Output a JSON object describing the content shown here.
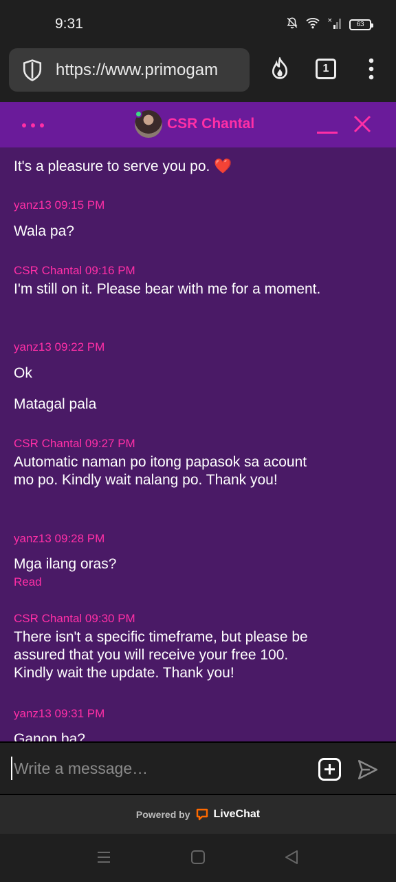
{
  "status_bar": {
    "time": "9:31",
    "battery": "63"
  },
  "browser": {
    "url": "https://www.primogam",
    "tab_count": "1",
    "icons": [
      "shield-icon",
      "fire-icon",
      "tabs-icon",
      "more-vertical-icon"
    ]
  },
  "chat": {
    "agent_name": "CSR Chantal",
    "header_icons": [
      "more-horizontal-icon",
      "minimize-icon",
      "close-icon"
    ],
    "accent_color": "#ff2fa6",
    "header_color": "#6a1b9a",
    "messages_bg": "#4a1a66"
  },
  "messages": {
    "m0": {
      "text": "It's a pleasure to serve you po. ❤️"
    },
    "m1": {
      "meta": "yanz13 09:15 PM",
      "text": "Wala pa?"
    },
    "m2": {
      "meta": "CSR Chantal 09:16 PM",
      "text": "I'm still on it. Please bear with me for a moment."
    },
    "m3": {
      "meta": "yanz13 09:22 PM",
      "text": "Ok",
      "text2": "Matagal pala"
    },
    "m4": {
      "meta": "CSR Chantal 09:27 PM",
      "text": "Automatic naman po itong papasok sa acount mo po. Kindly wait nalang po. Thank you!"
    },
    "m5": {
      "meta": "yanz13 09:28 PM",
      "text": "Mga ilang oras?",
      "status": "Read"
    },
    "m6": {
      "meta": "CSR Chantal 09:30 PM",
      "text": "There isn't a specific timeframe, but please be assured that you will receive your free 100. Kindly wait the update. Thank you!"
    },
    "m7": {
      "meta": "yanz13 09:31 PM",
      "text": "Ganon ba?"
    }
  },
  "composer": {
    "placeholder": "Write a message…",
    "value": ""
  },
  "footer": {
    "powered_label": "Powered by",
    "brand": "LiveChat"
  }
}
